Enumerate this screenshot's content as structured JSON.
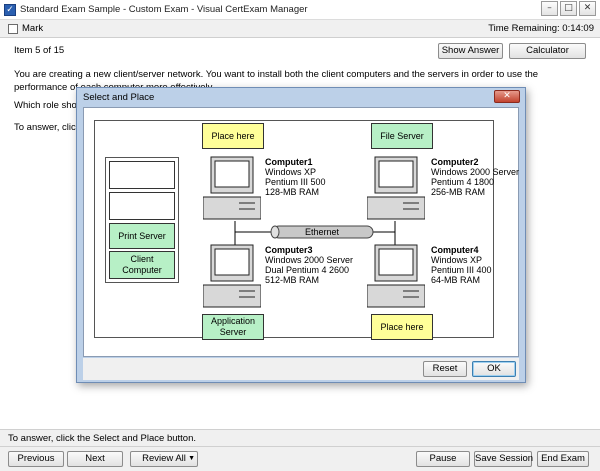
{
  "window": {
    "title": "Standard Exam Sample - Custom Exam - Visual CertExam Manager",
    "btn_min": "–",
    "btn_max": "□",
    "btn_close": "✕"
  },
  "toolbar": {
    "mark_label": "Mark",
    "time_remaining": "Time Remaining: 0:14:09"
  },
  "header": {
    "item_label": "Item 5 of 15",
    "show_answer": "Show Answer",
    "calculator": "Calculator"
  },
  "question": {
    "text": "You are creating a new client/server network. You want to install both the client computers and the servers in order to use the performance of each computer more effectively.",
    "which_role": "Which role shou",
    "to_answer": "To answer, click"
  },
  "dialog": {
    "title": "Select and Place",
    "close": "✕",
    "reset": "Reset",
    "ok": "OK",
    "targets": {
      "top_left": "Place here",
      "top_right": "File Server",
      "bottom_left": "Application Server",
      "bottom_right": "Place here"
    },
    "choices": [
      "",
      "",
      "Print Server",
      "Client Computer"
    ],
    "ethernet": "Ethernet",
    "computers": [
      {
        "name": "Computer1",
        "os": "Windows XP",
        "cpu": "Pentium III 500",
        "ram": "128-MB RAM"
      },
      {
        "name": "Computer2",
        "os": "Windows 2000 Server",
        "cpu": "Pentium 4 1800",
        "ram": "256-MB RAM"
      },
      {
        "name": "Computer3",
        "os": "Windows 2000 Server",
        "cpu": "Dual Pentium 4 2600",
        "ram": "512-MB RAM"
      },
      {
        "name": "Computer4",
        "os": "Windows XP",
        "cpu": "Pentium III 400",
        "ram": "64-MB RAM"
      }
    ]
  },
  "footer": {
    "instruction": "To answer, click the Select and Place button.",
    "previous": "Previous",
    "next": "Next",
    "review_all": "Review All",
    "pause": "Pause",
    "save_session": "Save Session",
    "end_exam": "End Exam"
  },
  "colors": {
    "place_here": "#ffff99",
    "placed": "#b7f0c6",
    "dialog_frame": "#bcd0e8"
  }
}
